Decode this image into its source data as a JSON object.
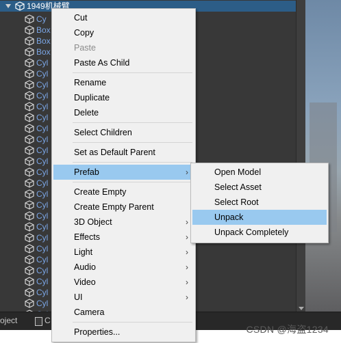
{
  "hierarchy": {
    "root_label": "1949机械臂",
    "rows": [
      "Box",
      "Box",
      "Box",
      "Cyl",
      "Cyl",
      "Cyl",
      "Cyl",
      "Cyl",
      "Cyl",
      "Cyl",
      "Cyl",
      "Cyl",
      "Cyl",
      "Cyl",
      "Cyl",
      "Cyl",
      "Cyl",
      "Cyl",
      "Cyl",
      "Cyl",
      "Cyl",
      "Cyl",
      "Cyl",
      "Cyl",
      "Cyl",
      "Cyl",
      "Cyl"
    ],
    "first_row_partial": "Cy",
    "last_row_partial": "Cyl"
  },
  "bottom_tabs": {
    "left": "oject",
    "console": "C"
  },
  "context_menu": {
    "groups": [
      [
        {
          "label": "Cut"
        },
        {
          "label": "Copy"
        },
        {
          "label": "Paste",
          "disabled": true
        },
        {
          "label": "Paste As Child"
        }
      ],
      [
        {
          "label": "Rename"
        },
        {
          "label": "Duplicate"
        },
        {
          "label": "Delete"
        }
      ],
      [
        {
          "label": "Select Children"
        }
      ],
      [
        {
          "label": "Set as Default Parent"
        }
      ],
      [
        {
          "label": "Prefab",
          "submenu": true,
          "highlighted": true
        }
      ],
      [
        {
          "label": "Create Empty"
        },
        {
          "label": "Create Empty Parent"
        },
        {
          "label": "3D Object",
          "submenu": true
        },
        {
          "label": "Effects",
          "submenu": true
        },
        {
          "label": "Light",
          "submenu": true
        },
        {
          "label": "Audio",
          "submenu": true
        },
        {
          "label": "Video",
          "submenu": true
        },
        {
          "label": "UI",
          "submenu": true
        },
        {
          "label": "Camera"
        }
      ],
      [
        {
          "label": "Properties..."
        }
      ]
    ]
  },
  "prefab_submenu": {
    "items": [
      {
        "label": "Open Model"
      },
      {
        "label": "Select Asset"
      },
      {
        "label": "Select Root"
      },
      {
        "label": "Unpack",
        "highlighted": true
      },
      {
        "label": "Unpack Completely"
      }
    ]
  },
  "watermark": "CSDN @海盗1234",
  "colors": {
    "panel_bg": "#383838",
    "selection_bg": "#2c5d87",
    "prefab_text": "#7ba6e6",
    "menu_bg": "#f0f0f0",
    "menu_highlight": "#99c9ef"
  }
}
